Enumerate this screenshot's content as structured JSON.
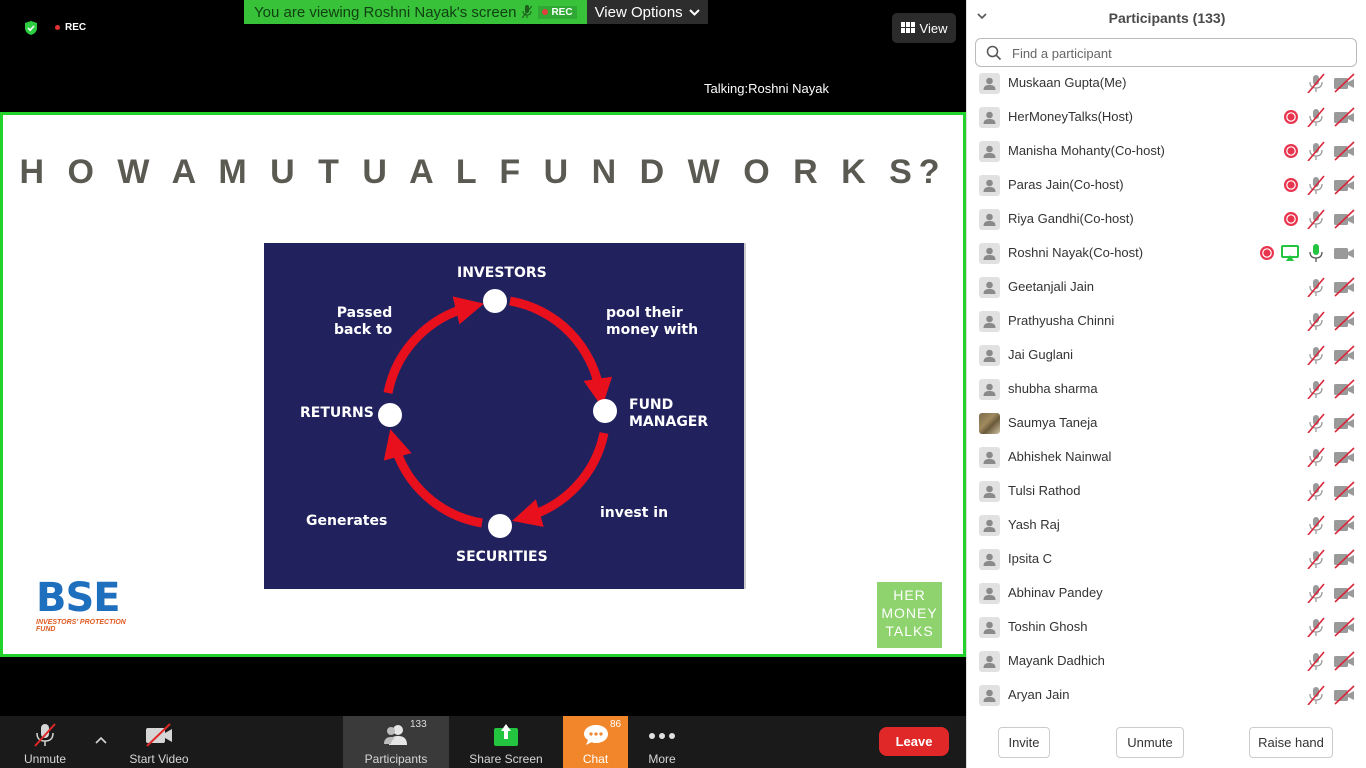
{
  "meeting": {
    "rec_label": "REC",
    "viewing_banner": "You are viewing Roshni Nayak's screen",
    "banner_rec": "REC",
    "view_options": "View Options",
    "view_button": "View",
    "talking": "Talking:Roshni Nayak"
  },
  "slide": {
    "title": "H O W A  M U T U A L  F U N D  W O R K S?",
    "diagram": {
      "investors": "INVESTORS",
      "pool": "pool their\nmoney with",
      "fund_manager": "FUND\nMANAGER",
      "invest": "invest in",
      "securities": "SECURITIES",
      "generates": "Generates",
      "returns": "RETURNS",
      "passed": "Passed\nback to"
    },
    "bse_logo": "BSE",
    "bse_sub": "INVESTORS' PROTECTION FUND",
    "hmt_logo": [
      "HER",
      "MONEY",
      "TALKS"
    ]
  },
  "toolbar": {
    "unmute": "Unmute",
    "start_video": "Start Video",
    "participants": "Participants",
    "participants_count": "133",
    "share_screen": "Share Screen",
    "chat": "Chat",
    "chat_count": "86",
    "more": "More",
    "leave": "Leave"
  },
  "panel": {
    "title": "Participants (133)",
    "search_placeholder": "Find a participant",
    "participants": [
      {
        "name": "Muskaan Gupta(Me)",
        "rec": false,
        "sharing": false,
        "mic": "muted",
        "video": "off",
        "avatar": "default"
      },
      {
        "name": "HerMoneyTalks(Host)",
        "rec": true,
        "sharing": false,
        "mic": "muted",
        "video": "off",
        "avatar": "default"
      },
      {
        "name": "Manisha Mohanty(Co-host)",
        "rec": true,
        "sharing": false,
        "mic": "muted",
        "video": "off",
        "avatar": "default"
      },
      {
        "name": "Paras Jain(Co-host)",
        "rec": true,
        "sharing": false,
        "mic": "muted",
        "video": "off",
        "avatar": "default"
      },
      {
        "name": "Riya Gandhi(Co-host)",
        "rec": true,
        "sharing": false,
        "mic": "muted",
        "video": "off",
        "avatar": "default"
      },
      {
        "name": "Roshni Nayak(Co-host)",
        "rec": true,
        "sharing": true,
        "mic": "active",
        "video": "on",
        "avatar": "default"
      },
      {
        "name": "Geetanjali Jain",
        "rec": false,
        "sharing": false,
        "mic": "muted",
        "video": "off",
        "avatar": "default"
      },
      {
        "name": "Prathyusha Chinni",
        "rec": false,
        "sharing": false,
        "mic": "muted",
        "video": "off",
        "avatar": "default"
      },
      {
        "name": "Jai Guglani",
        "rec": false,
        "sharing": false,
        "mic": "muted",
        "video": "off",
        "avatar": "default"
      },
      {
        "name": "shubha sharma",
        "rec": false,
        "sharing": false,
        "mic": "muted",
        "video": "off",
        "avatar": "default"
      },
      {
        "name": "Saumya Taneja",
        "rec": false,
        "sharing": false,
        "mic": "muted",
        "video": "off",
        "avatar": "photo"
      },
      {
        "name": "Abhishek Nainwal",
        "rec": false,
        "sharing": false,
        "mic": "muted",
        "video": "off",
        "avatar": "default"
      },
      {
        "name": "Tulsi Rathod",
        "rec": false,
        "sharing": false,
        "mic": "muted",
        "video": "off",
        "avatar": "default"
      },
      {
        "name": "Yash Raj",
        "rec": false,
        "sharing": false,
        "mic": "muted",
        "video": "off",
        "avatar": "default"
      },
      {
        "name": "Ipsita C",
        "rec": false,
        "sharing": false,
        "mic": "muted",
        "video": "off",
        "avatar": "default"
      },
      {
        "name": "Abhinav Pandey",
        "rec": false,
        "sharing": false,
        "mic": "muted",
        "video": "off",
        "avatar": "default"
      },
      {
        "name": "Toshin Ghosh",
        "rec": false,
        "sharing": false,
        "mic": "muted",
        "video": "off",
        "avatar": "default"
      },
      {
        "name": "Mayank Dadhich",
        "rec": false,
        "sharing": false,
        "mic": "muted",
        "video": "off",
        "avatar": "default"
      },
      {
        "name": "Aryan Jain",
        "rec": false,
        "sharing": false,
        "mic": "muted",
        "video": "off",
        "avatar": "default"
      }
    ],
    "invite": "Invite",
    "unmute": "Unmute",
    "raise_hand": "Raise hand"
  },
  "colors": {
    "share_border": "#23d12b",
    "banner_green": "#37c23a",
    "chat_orange": "#f2862b",
    "leave_red": "#e02828",
    "rec_red": "#e8344e",
    "muted_red": "#d9263b",
    "slide_bg": "#21215e"
  }
}
